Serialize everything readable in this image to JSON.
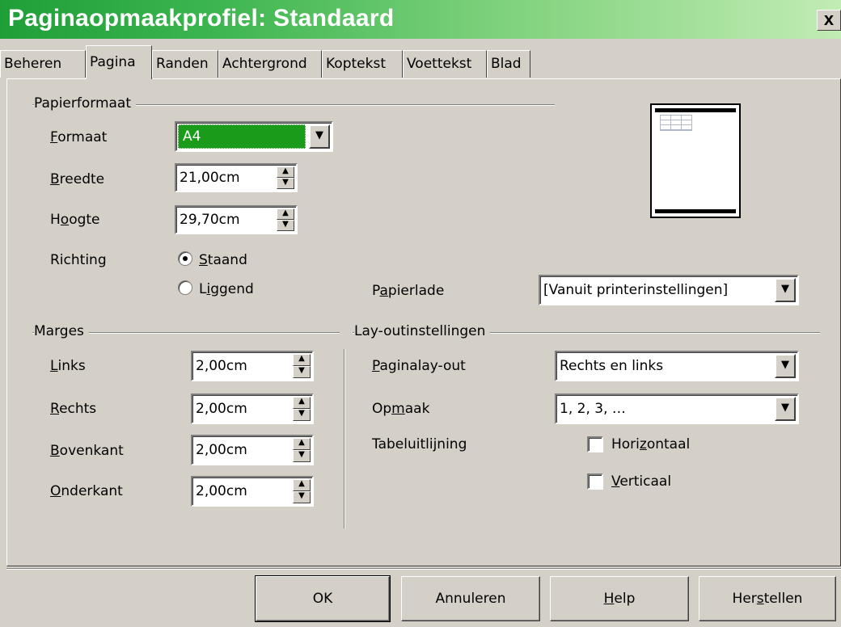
{
  "window": {
    "title": "Paginaopmaakprofiel: Standaard",
    "close_label": "x"
  },
  "tabs": [
    {
      "label": "Beheren"
    },
    {
      "label": "Pagina"
    },
    {
      "label": "Randen"
    },
    {
      "label": "Achtergrond"
    },
    {
      "label": "Koptekst"
    },
    {
      "label": "Voettekst"
    },
    {
      "label": "Blad"
    }
  ],
  "active_tab": "Pagina",
  "paper_format": {
    "group_label": "Papierformaat",
    "format_label": {
      "mnemonic": "F",
      "rest": "ormaat"
    },
    "format_value": "A4",
    "width_label": {
      "mnemonic": "B",
      "rest": "reedte"
    },
    "width_value": "21,00cm",
    "height_label": {
      "pre": "H",
      "mnemonic": "o",
      "rest": "ogte"
    },
    "height_value": "29,70cm",
    "orientation_label": "Richting",
    "portrait_label": {
      "mnemonic": "S",
      "rest": "taand"
    },
    "portrait_checked": true,
    "landscape_label": {
      "pre": "L",
      "mnemonic": "i",
      "rest": "ggend"
    },
    "landscape_checked": false,
    "paper_tray_label": {
      "pre": "P",
      "mnemonic": "a",
      "rest": "pierlade"
    },
    "paper_tray_value": "[Vanuit printerinstellingen]"
  },
  "margins": {
    "group_label": "Marges",
    "left_label": {
      "mnemonic": "L",
      "rest": "inks"
    },
    "left_value": "2,00cm",
    "right_label": {
      "mnemonic": "R",
      "rest": "echts"
    },
    "right_value": "2,00cm",
    "top_label": {
      "mnemonic": "B",
      "rest": "ovenkant"
    },
    "top_value": "2,00cm",
    "bottom_label": {
      "mnemonic": "O",
      "rest": "nderkant"
    },
    "bottom_value": "2,00cm"
  },
  "layout": {
    "group_label": "Lay-outinstellingen",
    "page_layout_label": {
      "mnemonic": "P",
      "rest": "aginalay-out"
    },
    "page_layout_value": "Rechts en links",
    "format_label": {
      "pre": "Op",
      "mnemonic": "m",
      "rest": "aak"
    },
    "format_value": "1, 2, 3, …",
    "table_alignment_label": "Tabeluitlijning",
    "horizontal_label": {
      "pre": "Hori",
      "mnemonic": "z",
      "rest": "ontaal"
    },
    "horizontal_checked": false,
    "vertical_label": {
      "mnemonic": "V",
      "rest": "erticaal"
    },
    "vertical_checked": false
  },
  "buttons": {
    "ok": "OK",
    "cancel": "Annuleren",
    "help": {
      "mnemonic": "H",
      "rest": "elp"
    },
    "reset": {
      "pre": "Her",
      "mnemonic": "s",
      "rest": "tellen"
    }
  },
  "colors": {
    "title_gradient_start": "#1f9e37",
    "title_gradient_end": "#c2ecb4",
    "selection": "#1a9b1a",
    "dialog_bg": "#d4d0c8"
  }
}
